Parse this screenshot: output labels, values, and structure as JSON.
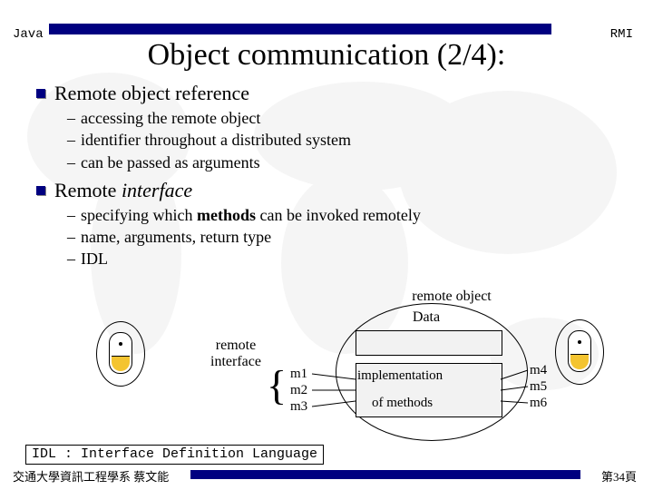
{
  "header": {
    "left": "Java",
    "right": "RMI"
  },
  "title": "Object communication (2/4):",
  "b1": {
    "head": "Remote object reference",
    "items": [
      "accessing the remote object",
      "identifier throughout a distributed system",
      "can be passed as arguments"
    ]
  },
  "b2": {
    "head_pre": "Remote ",
    "head_em": "interface",
    "items_pre": [
      "specifying which ",
      "name, arguments, return type",
      "IDL"
    ],
    "items_bold": "methods",
    "items_post": " can be invoked remotely"
  },
  "diagram": {
    "remote_interface": "remote\ninterface",
    "remote_object": "remote   object",
    "data": "Data",
    "impl1": "implementation",
    "impl2": "of methods",
    "m1": "m1",
    "m2": "m2",
    "m3": "m3",
    "m4": "m4",
    "m5": "m5",
    "m6": "m6",
    "brace": "{"
  },
  "idl": "IDL : Interface Definition Language",
  "footer": {
    "left": "交通大學資訊工程學系 蔡文能",
    "right": "第34頁"
  }
}
